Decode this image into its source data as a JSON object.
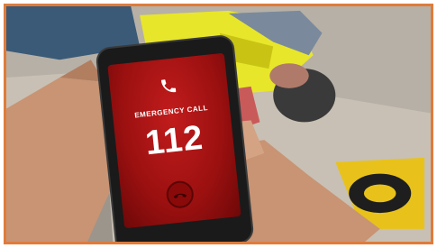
{
  "phone": {
    "call_label": "EMERGENCY CALL",
    "number": "112"
  },
  "colors": {
    "frame_border": "#e07b3a",
    "screen_red": "#b01515",
    "hi_vis_yellow": "#e8e62a"
  },
  "icons": {
    "call": "phone-handset-icon",
    "end": "end-call-icon"
  }
}
